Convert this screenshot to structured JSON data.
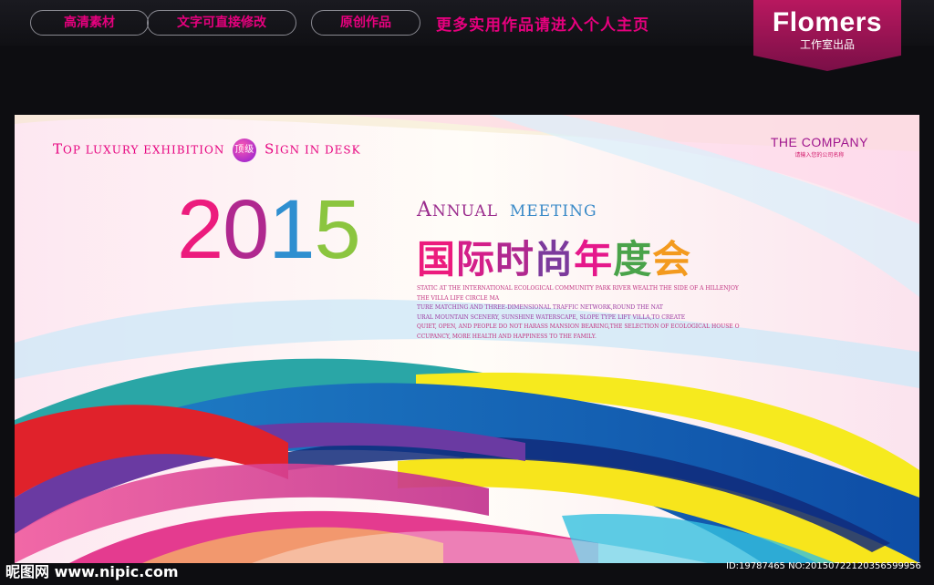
{
  "header": {
    "tags": [
      "高清素材",
      "文字可直接修改",
      "原创作品"
    ],
    "promo": "更多实用作品请进入个人主页",
    "brand_name": "Flomers",
    "brand_sub": "工作室出品"
  },
  "poster": {
    "topline": {
      "part1_cap": "T",
      "part1": "OP LUXURY EXHIBITION",
      "badge": "顶级",
      "part2_cap": "S",
      "part2": "IGN IN DESK"
    },
    "company_name": "THE COMPANY",
    "company_sub": "请输入您的公司名称",
    "year_digits": [
      "2",
      "0",
      "1",
      "5"
    ],
    "annual_cap": "A",
    "annual": "NNUAL",
    "meeting": "MEETING",
    "cn_title_chars": [
      "国",
      "际",
      "时",
      "尚",
      "年",
      "度",
      "会"
    ],
    "paragraph": [
      "STATIC AT THE INTERNATIONAL ECOLOGICAL COMMUNITY PARK RIVER WEALTH THE SIDE OF A HILLENJOY",
      "THE VILLA LIFE CIRCLE MA",
      "TURE MATCHING AND THREE-DIMENSIONAL TRAFFIC NETWORK,ROUND THE NAT",
      "URAL MOUNTAIN SCENERY, SUNSHINE WATERSCAPE, SLOPE TYPE LIFT VILLA,TO CREATE",
      "QUIET, OPEN, AND PEOPLE DO NOT HARASS MANSION BEARING,THE SELECTION OF ECOLOGICAL HOUSE O",
      "CCUPANCY, MORE HEALTH AND HAPPINESS TO THE FAMILY."
    ]
  },
  "watermark": {
    "left": "昵图网 www.nipic.com",
    "right": "ID:19787465 NO:20150722120356599956"
  }
}
